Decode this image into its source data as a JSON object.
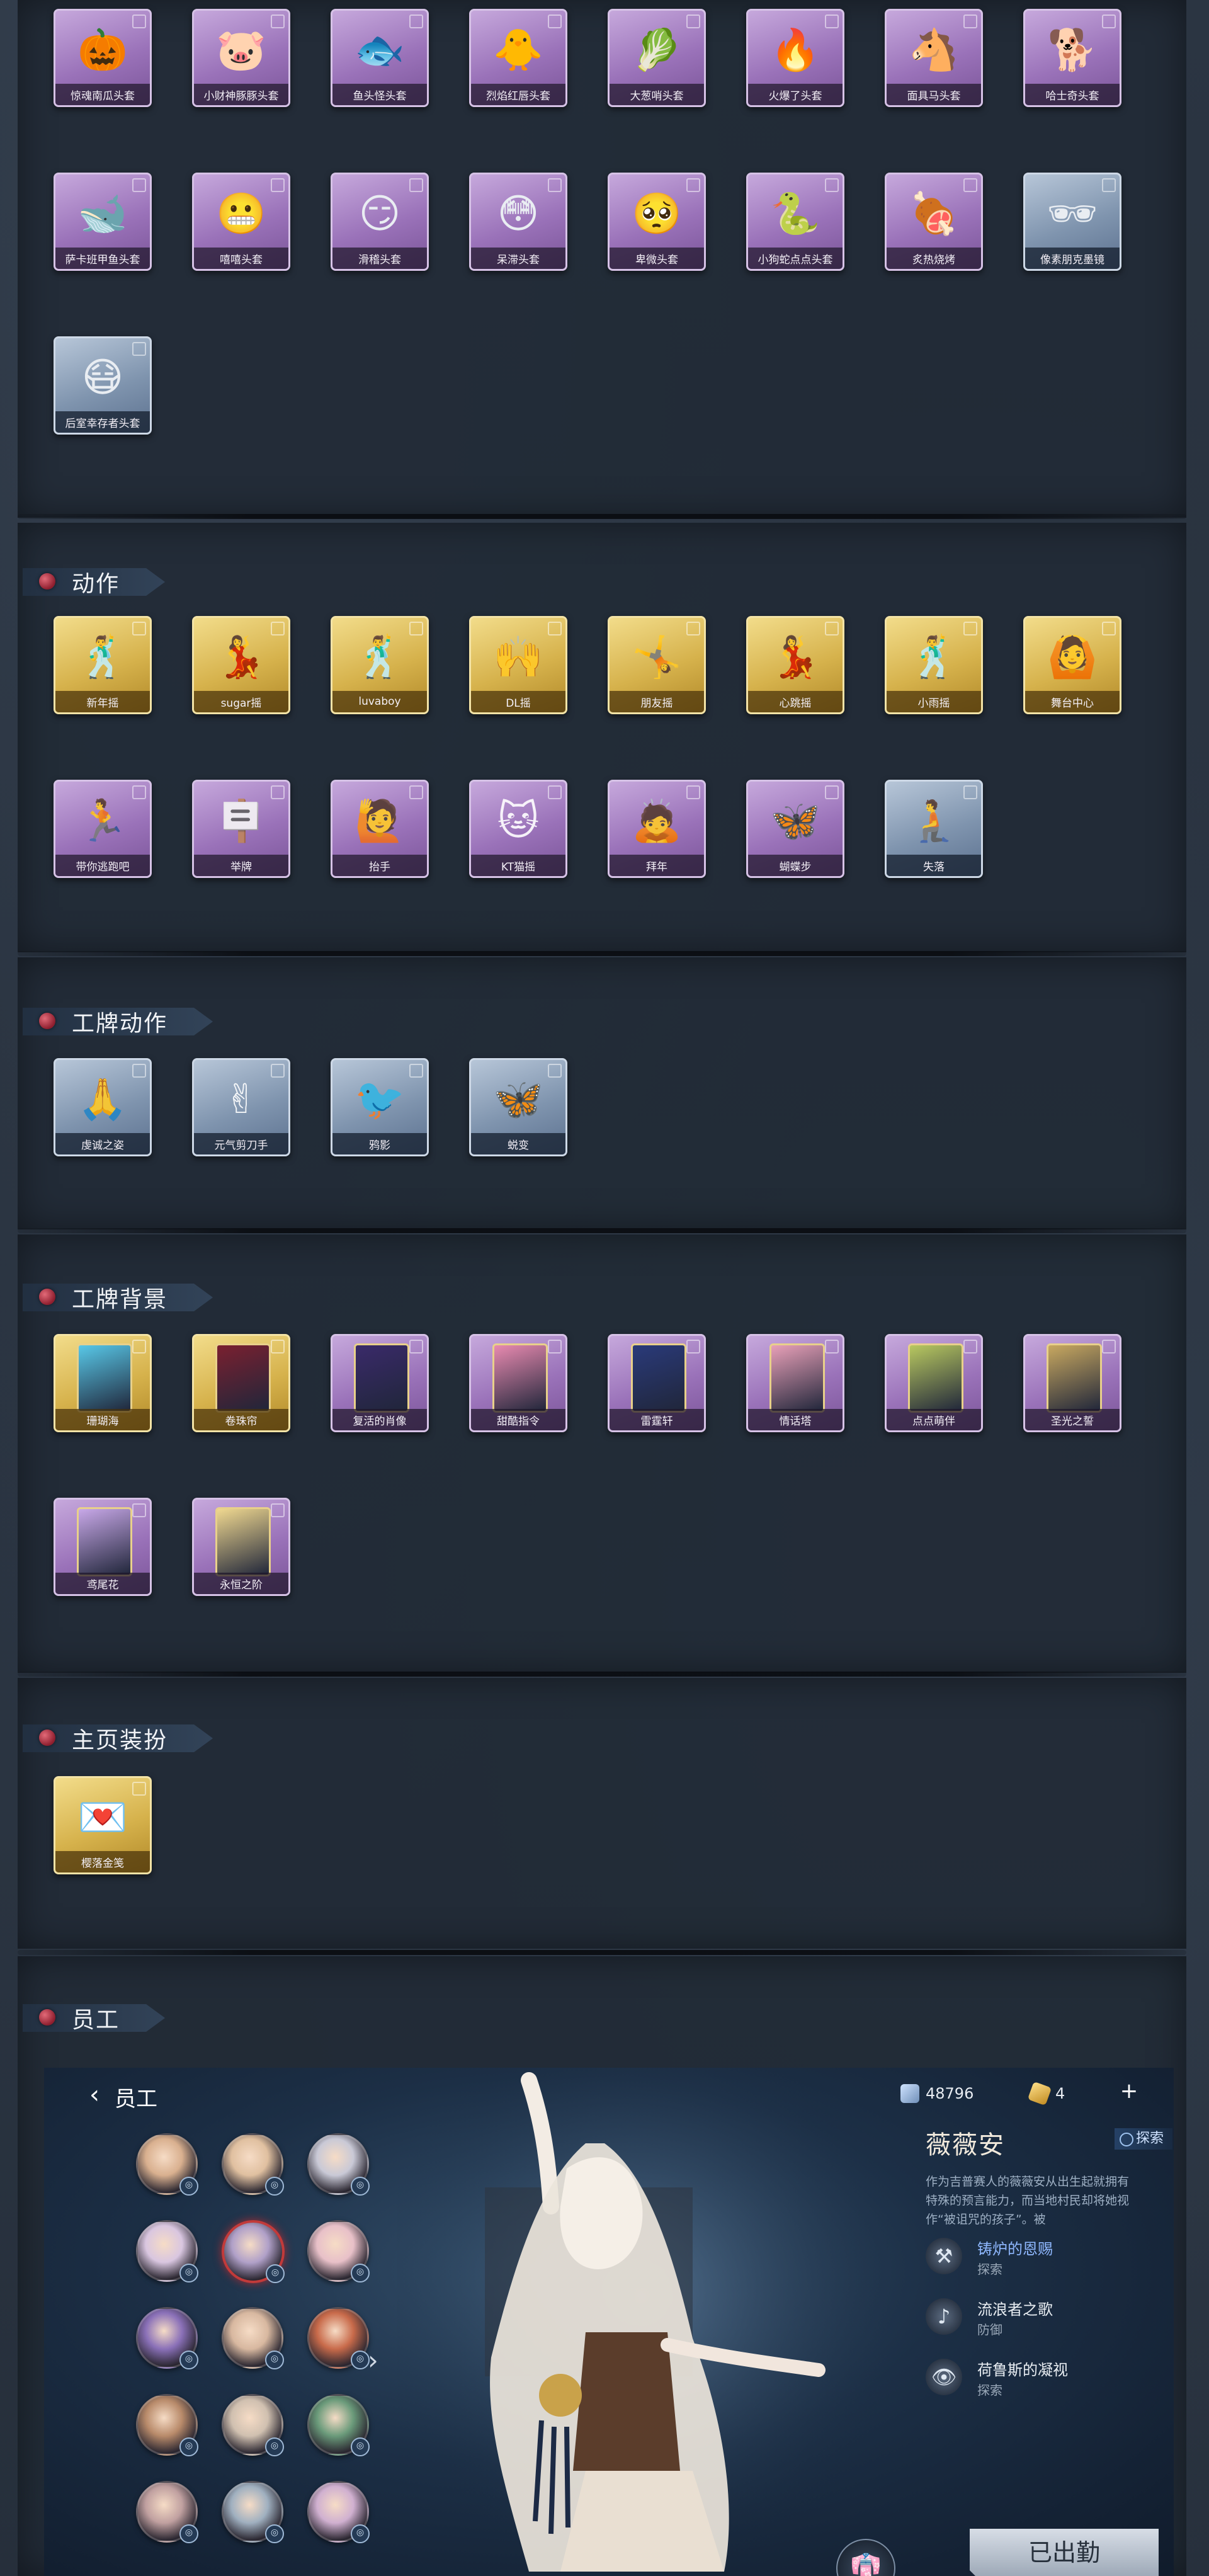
{
  "sections": {
    "accessories": {
      "items": [
        {
          "label": "惊魂南瓜头套",
          "icon": "pumpkin-icon",
          "glyph": "🎃",
          "tier": "purple"
        },
        {
          "label": "小财神豚豚头套",
          "icon": "pig-icon",
          "glyph": "🐷",
          "tier": "purple"
        },
        {
          "label": "鱼头怪头套",
          "icon": "fish-head-icon",
          "glyph": "🐟",
          "tier": "purple"
        },
        {
          "label": "烈焰红唇头套",
          "icon": "yellow-mascot-icon",
          "glyph": "🐥",
          "tier": "purple"
        },
        {
          "label": "大葱哨头套",
          "icon": "scallion-icon",
          "glyph": "🥬",
          "tier": "purple"
        },
        {
          "label": "火爆了头套",
          "icon": "fire-icon",
          "glyph": "🔥",
          "tier": "purple"
        },
        {
          "label": "面具马头套",
          "icon": "horse-icon",
          "glyph": "🐴",
          "tier": "purple"
        },
        {
          "label": "哈士奇头套",
          "icon": "husky-icon",
          "glyph": "🐕",
          "tier": "purple"
        },
        {
          "label": "萨卡班甲鱼头套",
          "icon": "armored-fish-icon",
          "glyph": "🐋",
          "tier": "purple"
        },
        {
          "label": "嘻嘻头套",
          "icon": "grin-emoji-icon",
          "glyph": "😬",
          "tier": "purple"
        },
        {
          "label": "滑稽头套",
          "icon": "smirk-emoji-icon",
          "glyph": "😏",
          "tier": "purple"
        },
        {
          "label": "呆滞头套",
          "icon": "dazed-emoji-icon",
          "glyph": "😳",
          "tier": "purple"
        },
        {
          "label": "卑微头套",
          "icon": "humble-emoji-icon",
          "glyph": "🥺",
          "tier": "purple"
        },
        {
          "label": "小狗蛇点点头套",
          "icon": "snake-icon",
          "glyph": "🐍",
          "tier": "purple"
        },
        {
          "label": "炙热烧烤",
          "icon": "bbq-icon",
          "glyph": "🍖",
          "tier": "purple"
        },
        {
          "label": "像素朋克墨镜",
          "icon": "pixel-sunglasses-icon",
          "glyph": "🕶",
          "tier": "blue"
        },
        {
          "label": "后室幸存者头套",
          "icon": "gas-mask-icon",
          "glyph": "😷",
          "tier": "blue"
        }
      ]
    },
    "actions": {
      "title": "动作",
      "items": [
        {
          "label": "新年摇",
          "icon": "pose-icon",
          "glyph": "🕺",
          "tier": "gold"
        },
        {
          "label": "sugar摇",
          "icon": "pose-icon",
          "glyph": "💃",
          "tier": "gold"
        },
        {
          "label": "luvaboy",
          "icon": "pose-icon",
          "glyph": "🕺",
          "tier": "gold"
        },
        {
          "label": "DL摇",
          "icon": "pose-icon",
          "glyph": "🙌",
          "tier": "gold"
        },
        {
          "label": "朋友摇",
          "icon": "pose-icon",
          "glyph": "🤸",
          "tier": "gold"
        },
        {
          "label": "心跳摇",
          "icon": "pose-icon",
          "glyph": "💃",
          "tier": "gold"
        },
        {
          "label": "小雨摇",
          "icon": "pose-icon",
          "glyph": "🕺",
          "tier": "gold"
        },
        {
          "label": "舞台中心",
          "icon": "pose-icon",
          "glyph": "🙆",
          "tier": "gold"
        },
        {
          "label": "带你逃跑吧",
          "icon": "run-pose-icon",
          "glyph": "🏃",
          "tier": "purple"
        },
        {
          "label": "举牌",
          "icon": "sign-pose-icon",
          "glyph": "🪧",
          "tier": "purple"
        },
        {
          "label": "抬手",
          "icon": "raise-hand-icon",
          "glyph": "🙋",
          "tier": "purple"
        },
        {
          "label": "KT猫摇",
          "icon": "cat-dance-icon",
          "glyph": "🐱",
          "tier": "purple"
        },
        {
          "label": "拜年",
          "icon": "bow-pose-icon",
          "glyph": "🙇",
          "tier": "purple"
        },
        {
          "label": "蝴蝶步",
          "icon": "butterfly-step-icon",
          "glyph": "🦋",
          "tier": "purple"
        },
        {
          "label": "失落",
          "icon": "crawl-pose-icon",
          "glyph": "🧎",
          "tier": "blue"
        }
      ]
    },
    "badge_actions": {
      "title": "工牌动作",
      "items": [
        {
          "label": "虔诚之姿",
          "icon": "badge-pose-icon",
          "glyph": "🙏",
          "tier": "blue"
        },
        {
          "label": "元气剪刀手",
          "icon": "badge-pose-icon",
          "glyph": "✌",
          "tier": "blue"
        },
        {
          "label": "鸦影",
          "icon": "badge-pose-icon",
          "glyph": "🐦",
          "tier": "blue"
        },
        {
          "label": "蜕变",
          "icon": "badge-pose-icon",
          "glyph": "🦋",
          "tier": "blue"
        }
      ]
    },
    "badge_backgrounds": {
      "title": "工牌背景",
      "items": [
        {
          "label": "珊瑚海",
          "icon": "coral-sea-card-icon",
          "color": "#58c8e8",
          "tier": "gold"
        },
        {
          "label": "卷珠帘",
          "icon": "curtain-card-icon",
          "color": "#7a2030",
          "tier": "gold"
        },
        {
          "label": "复活的肖像",
          "icon": "portrait-card-icon",
          "color": "#3a2a6a",
          "tier": "purple"
        },
        {
          "label": "甜酷指令",
          "icon": "pink-card-icon",
          "color": "#e88ab0",
          "tier": "purple"
        },
        {
          "label": "雷霆轩",
          "icon": "thunder-card-icon",
          "color": "#2a3a7a",
          "tier": "purple"
        },
        {
          "label": "情话塔",
          "icon": "tower-card-icon",
          "color": "#e8a0b8",
          "tier": "purple"
        },
        {
          "label": "点点萌伴",
          "icon": "companion-card-icon",
          "color": "#b8c860",
          "tier": "purple"
        },
        {
          "label": "圣光之誓",
          "icon": "holy-light-card-icon",
          "color": "#c8a860",
          "tier": "purple"
        },
        {
          "label": "鸢尾花",
          "icon": "iris-card-icon",
          "color": "#c8a8e8",
          "tier": "purple"
        },
        {
          "label": "永恒之阶",
          "icon": "eternal-steps-card-icon",
          "color": "#f0d890",
          "tier": "purple"
        }
      ]
    },
    "homepage_decor": {
      "title": "主页装扮",
      "items": [
        {
          "label": "樱落金笺",
          "icon": "sakura-letter-icon",
          "glyph": "💌",
          "tier": "gold"
        }
      ]
    },
    "staff": {
      "title": "员工",
      "screen": {
        "header_title": "员工",
        "currency_1": "48796",
        "currency_2": "4",
        "character_name": "薇薇安",
        "character_tag": "探索",
        "character_desc": "作为吉普赛人的薇薇安从出生起就拥有特殊的预言能力，而当地村民却将她视作“被诅咒的孩子”。被",
        "traits": [
          {
            "name": "铸炉的恩赐",
            "type": "探索",
            "icon": "forge-blessing-icon",
            "glyph": "⚒",
            "active": true
          },
          {
            "name": "流浪者之歌",
            "type": "防御",
            "icon": "wanderer-song-icon",
            "glyph": "♪",
            "active": false
          },
          {
            "name": "荷鲁斯的凝视",
            "type": "探索",
            "icon": "horus-eye-icon",
            "glyph": "👁",
            "active": false
          }
        ],
        "deploy_label": "已出勤"
      }
    }
  }
}
